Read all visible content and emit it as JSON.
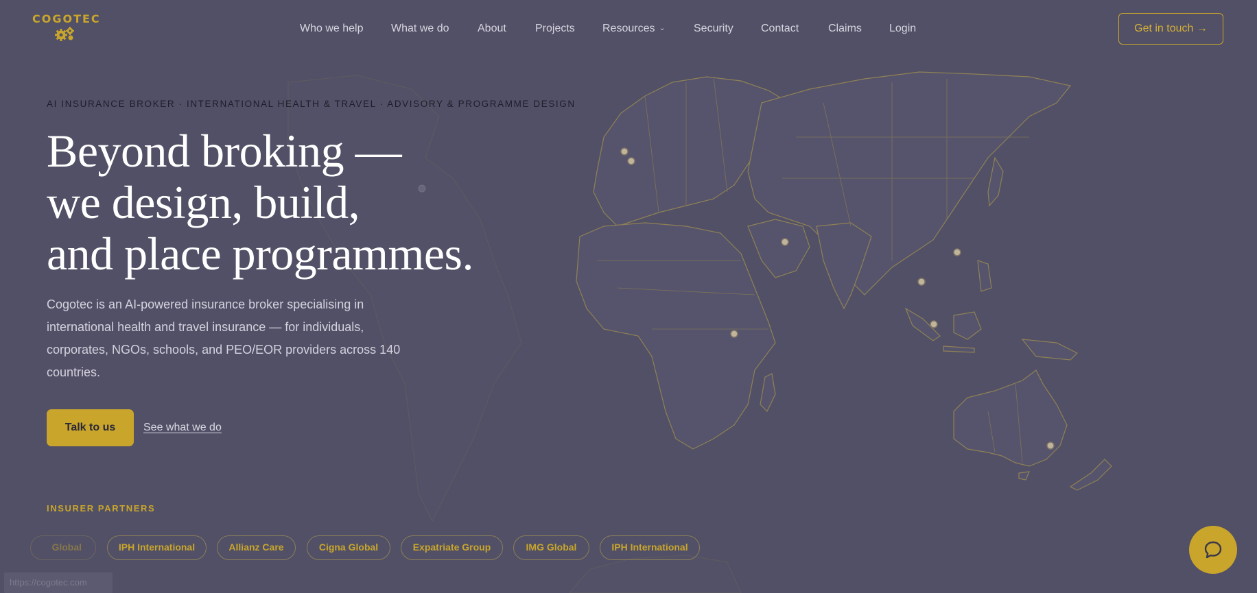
{
  "brand": {
    "name": "COGOTEC",
    "accent": "#c9a62b",
    "background": "#525066",
    "logo_icon": "gears-icon"
  },
  "nav": {
    "links": [
      "Who we help",
      "What we do",
      "About",
      "Projects",
      "Resources",
      "Security",
      "Contact",
      "Claims",
      "Login"
    ],
    "resources_dropdown_icon": "chevron-down-icon",
    "cta": "Get in touch →"
  },
  "hero": {
    "eyebrow": "AI INSURANCE BROKER · INTERNATIONAL HEALTH & TRAVEL · ADVISORY & PROGRAMME DESIGN",
    "headline": [
      "Beyond broking —",
      "we design, build,",
      "and place programmes."
    ],
    "lead": "Cogotec is an AI-powered insurance broker specialising in international health and travel insurance — for individuals, corporates, NGOs, schools, and PEO/EOR providers across 140 countries.",
    "primary_button": "Talk to us",
    "secondary_link": "See what we do"
  },
  "partners": {
    "title": "INSURER PARTNERS",
    "chips": [
      "Global",
      "IPH International",
      "Allianz Care",
      "Cigna Global",
      "Expatriate Group",
      "IMG Global",
      "IPH International"
    ]
  },
  "status_bar": {
    "url": "https://cogotec.com"
  },
  "chat": {
    "icon": "chat-bubble-icon"
  },
  "map": {
    "decorative": true
  }
}
